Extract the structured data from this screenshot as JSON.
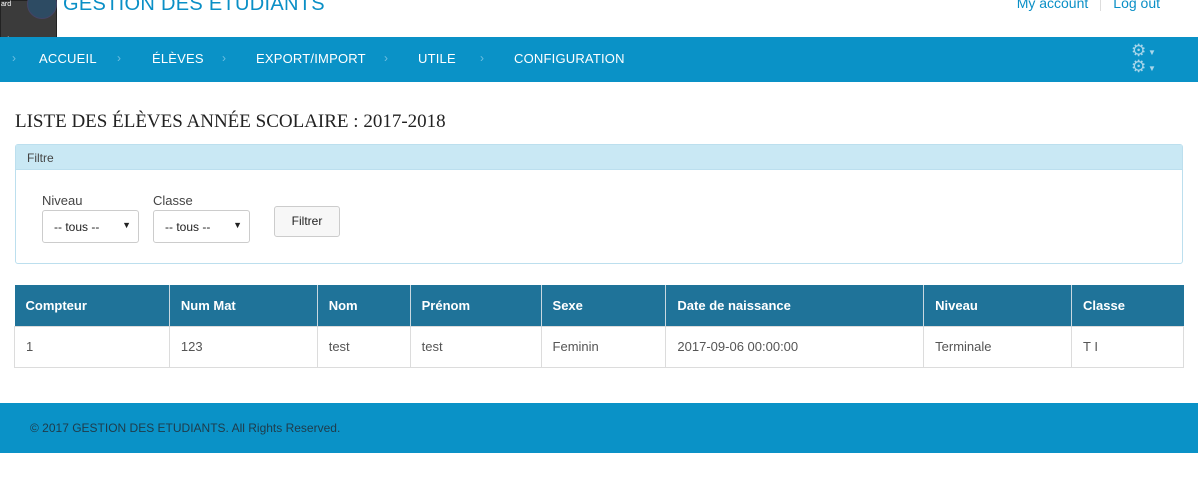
{
  "header": {
    "app_title": "GESTION DES ETUDIANTS",
    "overlay_label_top": "ard",
    "overlay_label_bottom": "ort",
    "my_account": "My account",
    "log_out": "Log out"
  },
  "nav": {
    "items": [
      "ACCUEIL",
      "ÉLÈVES",
      "EXPORT/IMPORT",
      "UTILE",
      "CONFIGURATION"
    ],
    "separator": "›",
    "gear_icon": "gear-icon"
  },
  "page": {
    "title": "LISTE DES ÉLÈVES ANNÉE SCOLAIRE : 2017-2018"
  },
  "filter": {
    "heading": "Filtre",
    "niveau_label": "Niveau",
    "niveau_value": "-- tous --",
    "classe_label": "Classe",
    "classe_value": "-- tous --",
    "submit_label": "Filtrer"
  },
  "table": {
    "columns": [
      "Compteur",
      "Num Mat",
      "Nom",
      "Prénom",
      "Sexe",
      "Date de naissance",
      "Niveau",
      "Classe"
    ],
    "rows": [
      [
        "1",
        "123",
        "test",
        "test",
        "Feminin",
        "2017-09-06 00:00:00",
        "Terminale",
        "T I"
      ]
    ]
  },
  "footer": {
    "text": "© 2017 GESTION DES ETUDIANTS. All Rights Reserved."
  },
  "colors": {
    "brand_blue": "#0a92c7",
    "table_header": "#1f7399",
    "filter_header": "#c9e8f4"
  }
}
